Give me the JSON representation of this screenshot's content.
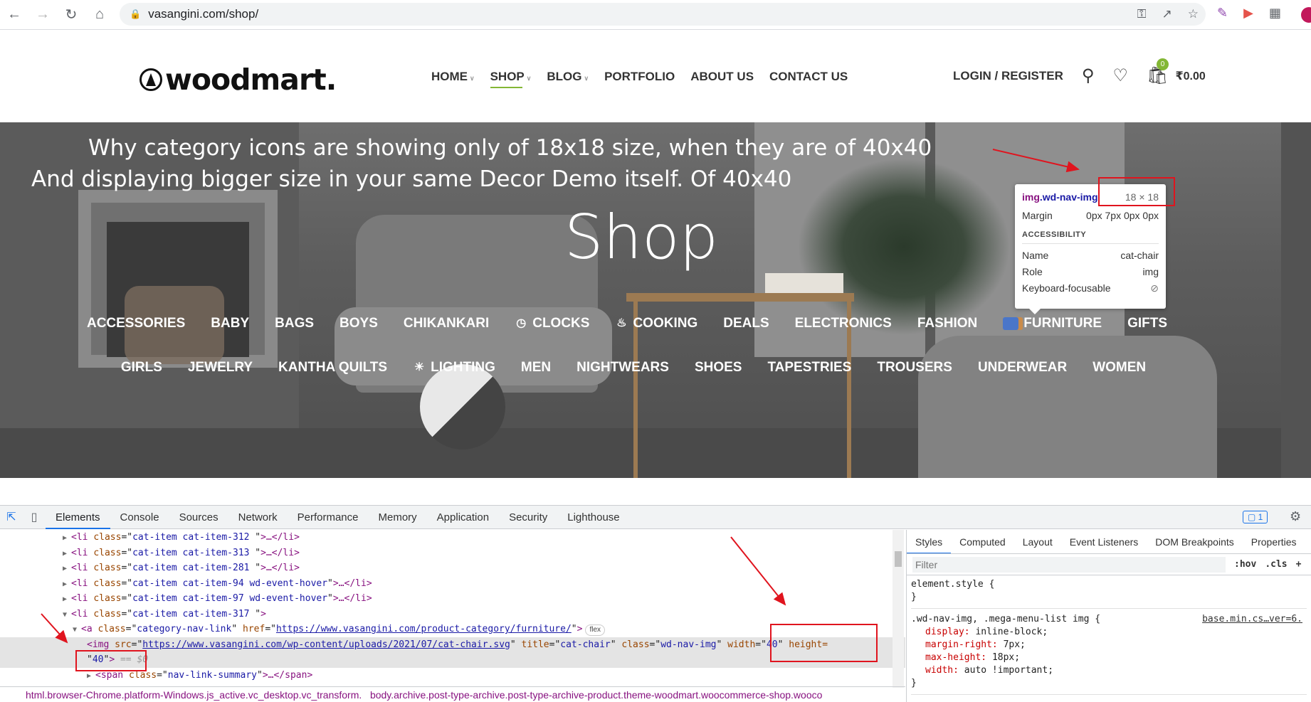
{
  "browser": {
    "url": "vasangini.com/shop/",
    "icons": [
      "back-icon",
      "forward-icon",
      "reload-icon",
      "home-icon",
      "lock-icon",
      "key-icon",
      "share-icon",
      "star-icon",
      "pen-extension-icon",
      "record-extension-icon",
      "puzzle-icon"
    ]
  },
  "site": {
    "logo": "woodmart.",
    "nav": [
      {
        "label": "HOME",
        "has_dropdown": true
      },
      {
        "label": "SHOP",
        "has_dropdown": true,
        "active": true
      },
      {
        "label": "BLOG",
        "has_dropdown": true
      },
      {
        "label": "PORTFOLIO",
        "has_dropdown": false
      },
      {
        "label": "ABOUT US",
        "has_dropdown": false
      },
      {
        "label": "CONTACT US",
        "has_dropdown": false
      }
    ],
    "login": "LOGIN / REGISTER",
    "cart_count": "0",
    "cart_total": "₹0.00",
    "accent_color": "#83b735"
  },
  "hero": {
    "question_line1": "Why category icons are showing only of 18x18 size, when they are of 40x40",
    "question_line2": "And displaying bigger size in your same Decor Demo itself. Of 40x40",
    "title": "Shop",
    "categories_row1": [
      {
        "label": "ACCESSORIES"
      },
      {
        "label": "BABY"
      },
      {
        "label": "BAGS"
      },
      {
        "label": "BOYS"
      },
      {
        "label": "CHIKANKARI"
      },
      {
        "label": "CLOCKS",
        "icon": "clock-icon"
      },
      {
        "label": "COOKING",
        "icon": "cooking-icon"
      },
      {
        "label": "DEALS"
      },
      {
        "label": "ELECTRONICS"
      },
      {
        "label": "FASHION"
      },
      {
        "label": "FURNITURE",
        "icon": "chair-icon"
      },
      {
        "label": "GIFTS"
      }
    ],
    "categories_row2": [
      {
        "label": "GIRLS"
      },
      {
        "label": "JEWELRY"
      },
      {
        "label": "KANTHA QUILTS"
      },
      {
        "label": "LIGHTING",
        "icon": "bulb-icon"
      },
      {
        "label": "MEN"
      },
      {
        "label": "NIGHTWEARS"
      },
      {
        "label": "SHOES"
      },
      {
        "label": "TAPESTRIES"
      },
      {
        "label": "TROUSERS"
      },
      {
        "label": "UNDERWEAR"
      },
      {
        "label": "WOMEN"
      }
    ]
  },
  "tooltip": {
    "selector_tag": "img",
    "selector_class": ".wd-nav-img",
    "size": "18 × 18",
    "margin_label": "Margin",
    "margin_value": "0px 7px 0px 0px",
    "section": "ACCESSIBILITY",
    "name_label": "Name",
    "name_value": "cat-chair",
    "role_label": "Role",
    "role_value": "img",
    "focus_label": "Keyboard-focusable"
  },
  "devtools": {
    "tabs": [
      "Elements",
      "Console",
      "Sources",
      "Network",
      "Performance",
      "Memory",
      "Application",
      "Security",
      "Lighthouse"
    ],
    "active_tab": "Elements",
    "issues_badge": "1",
    "dom_lines": [
      {
        "cls": "cat-item cat-item-312 "
      },
      {
        "cls": "cat-item cat-item-313 "
      },
      {
        "cls": "cat-item cat-item-281 "
      },
      {
        "cls": "cat-item cat-item-94  wd-event-hover"
      },
      {
        "cls": "cat-item cat-item-97  wd-event-hover"
      }
    ],
    "open_li_class": "cat-item cat-item-317 ",
    "a_class": "category-nav-link",
    "a_href": "https://www.vasangini.com/product-category/furniture/",
    "flex_pill": "flex",
    "img_src": "https://www.vasangini.com/wp-content/uploads/2021/07/cat-chair.svg",
    "img_title": "cat-chair",
    "img_class": "wd-nav-img",
    "img_width": "40",
    "img_height": "40",
    "dollar": "== $0",
    "span_class": "nav-link-summary",
    "breadcrumb_1": "html.browser-Chrome.platform-Windows.js_active.vc_desktop.vc_transform.",
    "breadcrumb_2": "body.archive.post-type-archive.post-type-archive-product.theme-woodmart.woocommerce-shop.wooco",
    "styles_tabs": [
      "Styles",
      "Computed",
      "Layout",
      "Event Listeners",
      "DOM Breakpoints",
      "Properties"
    ],
    "filter_placeholder": "Filter",
    "hov": ":hov",
    "cls": ".cls",
    "plus": "+",
    "element_style": "element.style {",
    "rule_selector": ".wd-nav-img, .mega-menu-list img {",
    "rule_source": "base.min.cs…ver=6.",
    "rule_props": [
      {
        "prop": "display",
        "val": "inline-block;"
      },
      {
        "prop": "margin-right",
        "val": "7px;"
      },
      {
        "prop": "max-height",
        "val": "18px;"
      },
      {
        "prop": "width",
        "val": "auto !important;"
      }
    ]
  }
}
